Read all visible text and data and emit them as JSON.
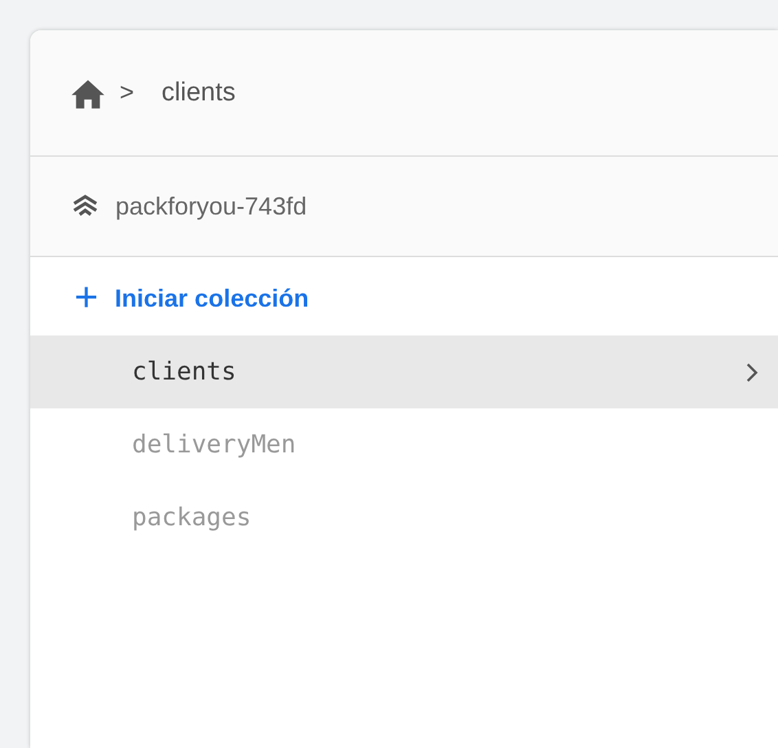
{
  "breadcrumb": {
    "separator": ">",
    "current": "clients"
  },
  "project": {
    "name": "packforyou-743fd"
  },
  "add_collection": {
    "icon": "+",
    "label": "Iniciar colección"
  },
  "collections": [
    {
      "name": "clients",
      "selected": true
    },
    {
      "name": "deliveryMen",
      "selected": false
    },
    {
      "name": "packages",
      "selected": false
    }
  ]
}
